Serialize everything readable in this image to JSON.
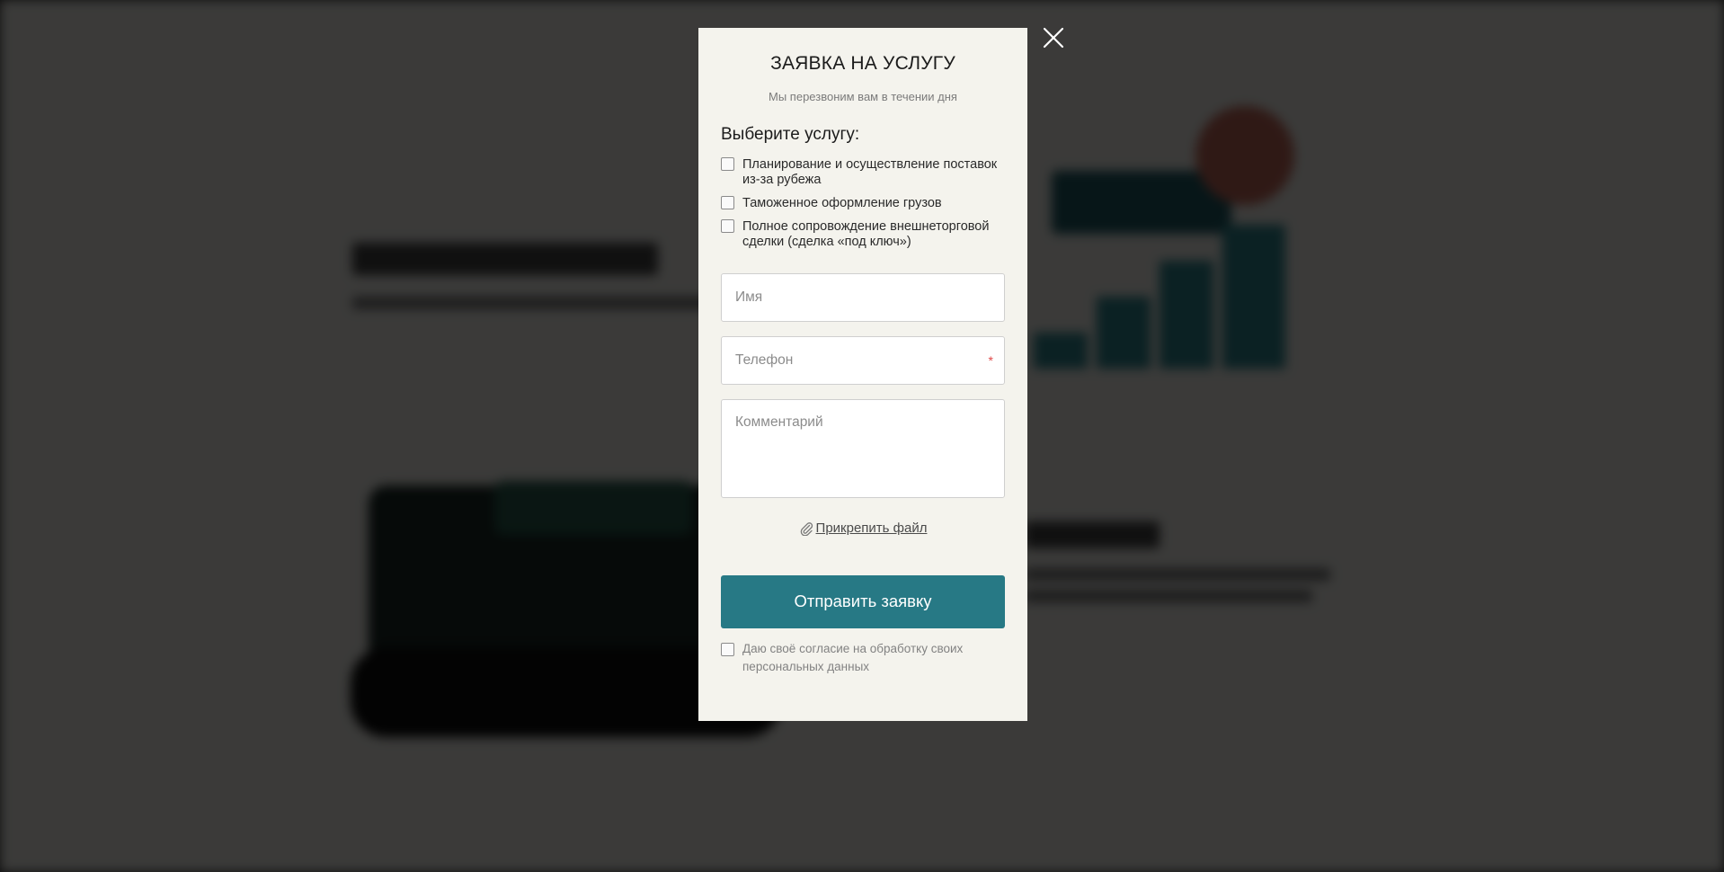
{
  "modal": {
    "title": "ЗАЯВКА НА УСЛУГУ",
    "subtitle": "Мы перезвоним вам в течении дня",
    "services_title": "Выберите услугу:",
    "services": [
      {
        "label": "Планирование и осуществление поставок из-за рубежа",
        "checked": false
      },
      {
        "label": "Таможенное оформление грузов",
        "checked": false
      },
      {
        "label": "Полное сопровождение внешнеторговой сделки (сделка «под ключ»)",
        "checked": false
      }
    ],
    "fields": {
      "name_placeholder": "Имя",
      "phone_placeholder": "Телефон",
      "phone_required_mark": "*",
      "comment_placeholder": "Комментарий"
    },
    "attach_label": "Прикрепить файл",
    "submit_label": "Отправить заявку",
    "consent_label": "Даю своё согласие на обработку своих персональных данных",
    "consent_checked": false
  },
  "colors": {
    "accent": "#277985",
    "required": "#e04848",
    "modal_bg": "#f4f3ed",
    "overlay": "rgba(0,0,0,0.76)"
  },
  "icons": {
    "close": "close-icon",
    "attach": "paperclip-icon"
  }
}
